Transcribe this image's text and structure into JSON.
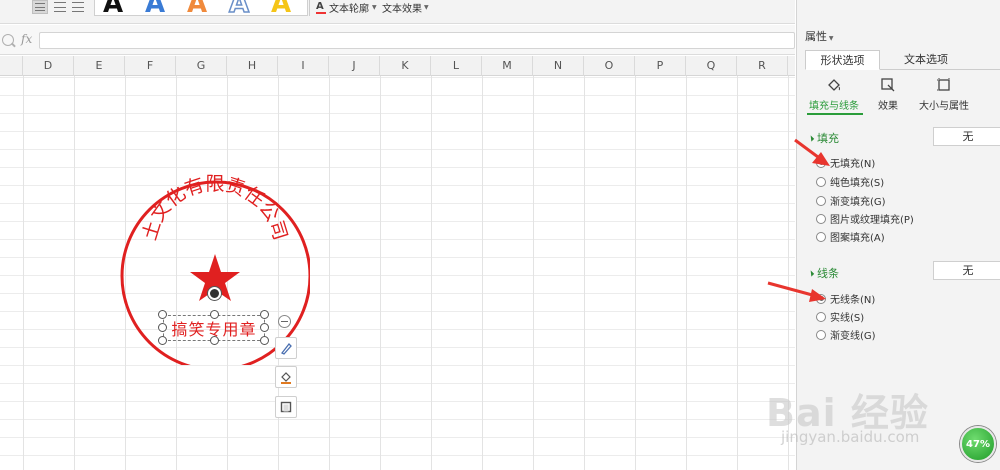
{
  "ribbon": {
    "art_letters": [
      "A",
      "A",
      "A",
      "A",
      "A"
    ],
    "text_outline_label": "文本轮廓",
    "text_effect_label": "文本效果"
  },
  "formula_bar": {
    "fx": "fx",
    "value": ""
  },
  "columns": [
    "E",
    "D",
    "E",
    "F",
    "G",
    "H",
    "I",
    "J",
    "K",
    "L",
    "M",
    "N",
    "O",
    "P",
    "Q",
    "R"
  ],
  "seal": {
    "arc_text": "土文化有限责任公司",
    "body_text": "搞笑专用章",
    "color": "#e02020"
  },
  "panel": {
    "title": "属性",
    "tabs": [
      "形状选项",
      "文本选项"
    ],
    "subtabs": [
      "填充与线条",
      "效果",
      "大小与属性"
    ],
    "fill": {
      "heading": "填充",
      "value": "无",
      "options": [
        "无填充(N)",
        "纯色填充(S)",
        "渐变填充(G)",
        "图片或纹理填充(P)",
        "图案填充(A)"
      ],
      "selected": 0
    },
    "line": {
      "heading": "线条",
      "value": "无",
      "options": [
        "无线条(N)",
        "实线(S)",
        "渐变线(G)"
      ],
      "selected": 0
    }
  },
  "watermark": {
    "brand": "Bai 经验",
    "sub": "jingyan.baidu.com"
  },
  "progress": {
    "value": "47%"
  },
  "colors": {
    "accent": "#2a9c3a",
    "seal_red": "#e02020",
    "arrow_red": "#e8352e"
  }
}
